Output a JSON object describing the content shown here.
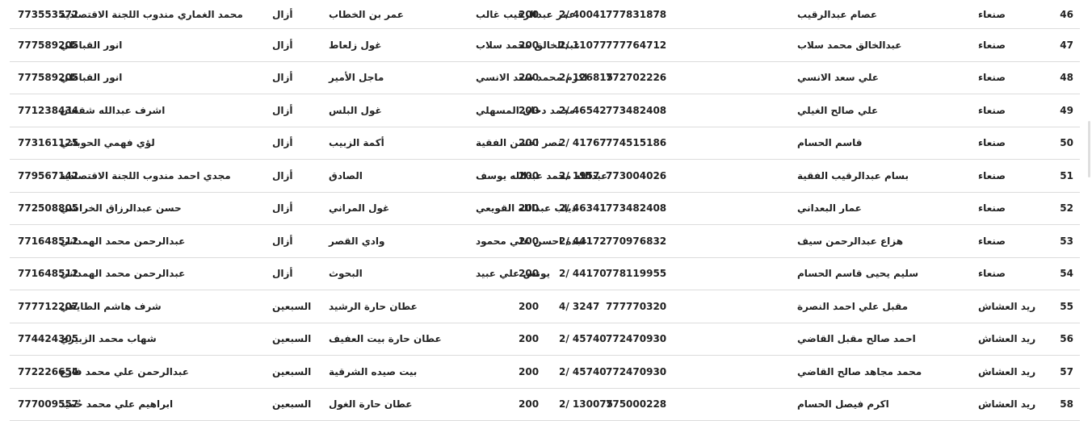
{
  "rows": [
    {
      "num": "46",
      "city": "صنعاء",
      "name": "عصام عبدالرقيب",
      "recipient": "عمر عبدالرقيب غالب",
      "phone": "777831878",
      "ref": "2/ 40041",
      "amount": "200",
      "place": "عمر بن الخطاب",
      "district": "أزال",
      "agent": "محمد الغماري مندوب اللجنة الاقتصادية",
      "agent_phone": "773553572"
    },
    {
      "num": "47",
      "city": "صنعاء",
      "name": "عبدالخالق محمد سلاب",
      "recipient": "عبدالخالق محمد سلاب",
      "phone": "777764712",
      "ref": "2/ 11077",
      "amount": "200",
      "place": "غول زلعاط",
      "district": "أزال",
      "agent": "انور القباطي",
      "agent_phone": "777589205"
    },
    {
      "num": "48",
      "city": "صنعاء",
      "name": "علي سعد الانسي",
      "recipient": "اكرم محمد سعد الانسي",
      "phone": "772702226",
      "ref": "2/ 126815",
      "amount": "200",
      "place": "ماجل الأمير",
      "district": "أزال",
      "agent": "انور القباطي",
      "agent_phone": "777589205"
    },
    {
      "num": "49",
      "city": "صنعاء",
      "name": "علي صالح الغيلي",
      "recipient": "محمد دحان المسهلي",
      "phone": "773482408",
      "ref": "2/ 46542",
      "amount": "200",
      "place": "غول البلس",
      "district": "أزال",
      "agent": "اشرف عبدالله شقحان",
      "agent_phone": "771238434"
    },
    {
      "num": "50",
      "city": "صنعاء",
      "name": "قاسم الحسام",
      "recipient": "نصر احسن الفقية",
      "phone": "774515186",
      "ref": "2/ 41767",
      "amount": "200",
      "place": "أكمة الزبيب",
      "district": "أزال",
      "agent": "لؤي فهمي الحوباني",
      "agent_phone": "773161125"
    },
    {
      "num": "51",
      "city": "صنعاء",
      "name": "بسام عبدالرقيب الفقية",
      "recipient": "عبدالله محمد عبدالله يوسف",
      "phone": "773004026",
      "ref": "2/ 1957",
      "amount": "200",
      "place": "الصادق",
      "district": "أزال",
      "agent": "مجدي احمد مندوب اللجنة الاقتصادية",
      "agent_phone": "779567142"
    },
    {
      "num": "52",
      "city": "صنعاء",
      "name": "عمار البعداني",
      "recipient": "ذياب عبدالله القويعي",
      "phone": "773482408",
      "ref": "2/ 46341",
      "amount": "200",
      "place": "غول المراني",
      "district": "أزال",
      "agent": "حسن عبدالرزاق الخراشي",
      "agent_phone": "772508805"
    },
    {
      "num": "53",
      "city": "صنعاء",
      "name": "هزاع عبدالرحمن سيف",
      "recipient": "عبدة احسن علي محمود",
      "phone": "770976832",
      "ref": "2/ 44172",
      "amount": "200",
      "place": "وادي القصر",
      "district": "أزال",
      "agent": "عبدالرحمن محمد الهمداني",
      "agent_phone": "771648512"
    },
    {
      "num": "54",
      "city": "صنعاء",
      "name": "سليم يحيى قاسم الحسام",
      "recipient": "يونس علي عبيد",
      "phone": "778119955",
      "ref": "2/ 44170",
      "amount": "200",
      "place": "البحوث",
      "district": "أزال",
      "agent": "عبدالرحمن محمد الهمداني",
      "agent_phone": "771648512"
    },
    {
      "num": "55",
      "city": "ريد العشاش",
      "name": "مقبل علي احمد النصرة",
      "recipient": "",
      "phone": "777770320",
      "ref": "4/ 3247",
      "amount": "200",
      "place": "عطان حارة الرشيد",
      "district": "السبعين",
      "agent": "شرف هاشم الطايفي",
      "agent_phone": "777712207"
    },
    {
      "num": "56",
      "city": "ريد العشاش",
      "name": "احمد صالح مقبل القاضي",
      "recipient": "",
      "phone": "772470930",
      "ref": "2/ 45740",
      "amount": "200",
      "place": "عطان حارة بيت العفيف",
      "district": "السبعين",
      "agent": "شهاب محمد الزبيري",
      "agent_phone": "774424305"
    },
    {
      "num": "57",
      "city": "ريد العشاش",
      "name": "محمد مجاهد صالح القاضي",
      "recipient": "",
      "phone": "772470930",
      "ref": "2/ 45740",
      "amount": "200",
      "place": "بيت صيده الشرقية",
      "district": "السبعين",
      "agent": "عبدالرحمن علي محمد فارع",
      "agent_phone": "772226654"
    },
    {
      "num": "58",
      "city": "ريد العشاش",
      "name": "اكرم فيصل الحسام",
      "recipient": "",
      "phone": "775000228",
      "ref": "2/ 130075",
      "amount": "200",
      "place": "عطان حارة الغول",
      "district": "السبعين",
      "agent": "ابراهيم علي محمد حُميد",
      "agent_phone": "777009557"
    }
  ]
}
